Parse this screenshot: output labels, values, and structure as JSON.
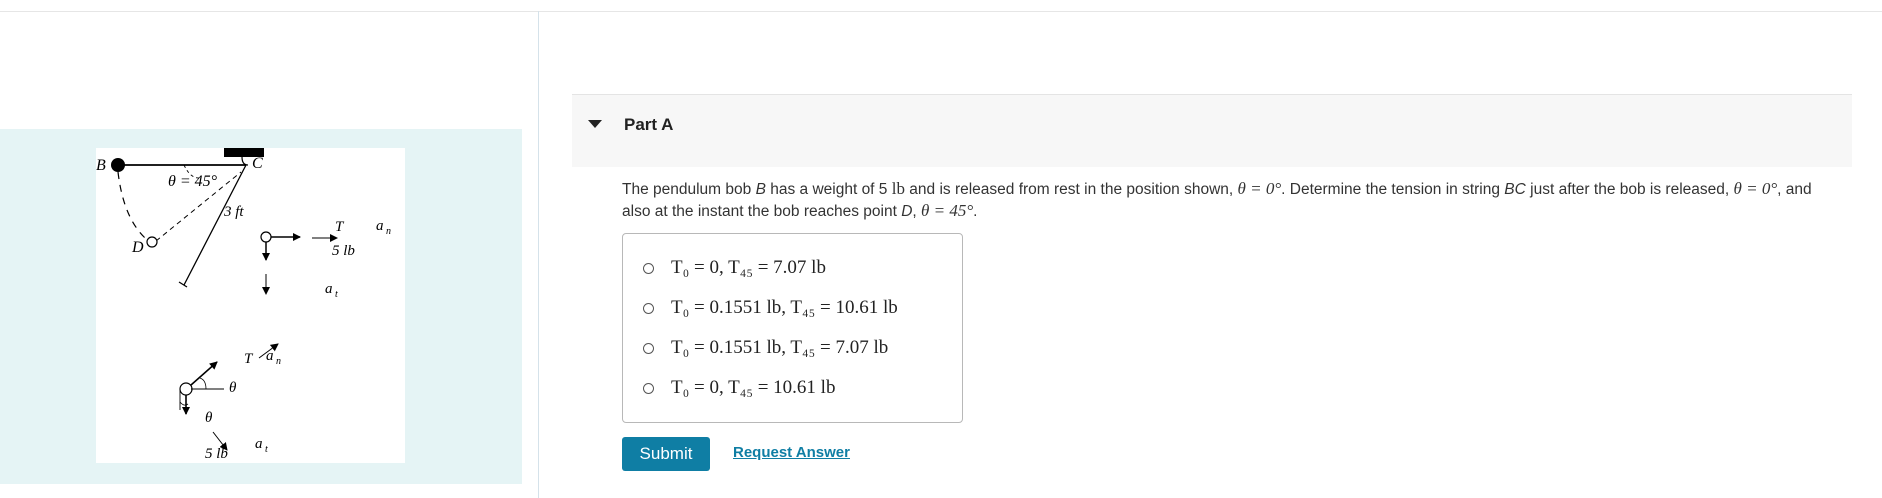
{
  "figure": {
    "labels": {
      "point_b": "B",
      "point_c": "C",
      "point_d": "D",
      "angle_eq": "θ = 45°",
      "length": "3 ft",
      "tension_1": "T",
      "weight_1": "5 lb",
      "an_1": "a",
      "an_1_sub": "n",
      "at_1": "a",
      "at_1_sub": "t",
      "tension_2": "T",
      "an_2": "a",
      "an_2_sub": "n",
      "theta_a": "θ",
      "theta_b": "θ",
      "weight_2": "5 lb",
      "at_2": "a",
      "at_2_sub": "t"
    }
  },
  "part": {
    "title": "Part A"
  },
  "question": {
    "t1": "The pendulum bob ",
    "b": "B",
    "t2": " has a weight of 5 ",
    "lb": "lb",
    "t3": " and is released from rest in the position shown, ",
    "theta0": "θ = 0°",
    "t4": ". Determine the tension in string ",
    "bc": "BC",
    "t5": " just after the bob is released, ",
    "theta0b": "θ = 0°",
    "t6": ", and also at the instant the bob reaches point ",
    "d": "D",
    "t7": ", ",
    "theta45": "θ = 45°",
    "t8": "."
  },
  "choices": [
    "T₀ = 0,  T₄₅ = 7.07 lb",
    "T₀ = 0.1551 lb,  T₄₅ = 10.61 lb",
    "T₀ = 0.1551 lb,  T₄₅ = 7.07 lb",
    "T₀ = 0,  T₄₅ = 10.61 lb"
  ],
  "actions": {
    "submit": "Submit",
    "request": "Request Answer"
  }
}
